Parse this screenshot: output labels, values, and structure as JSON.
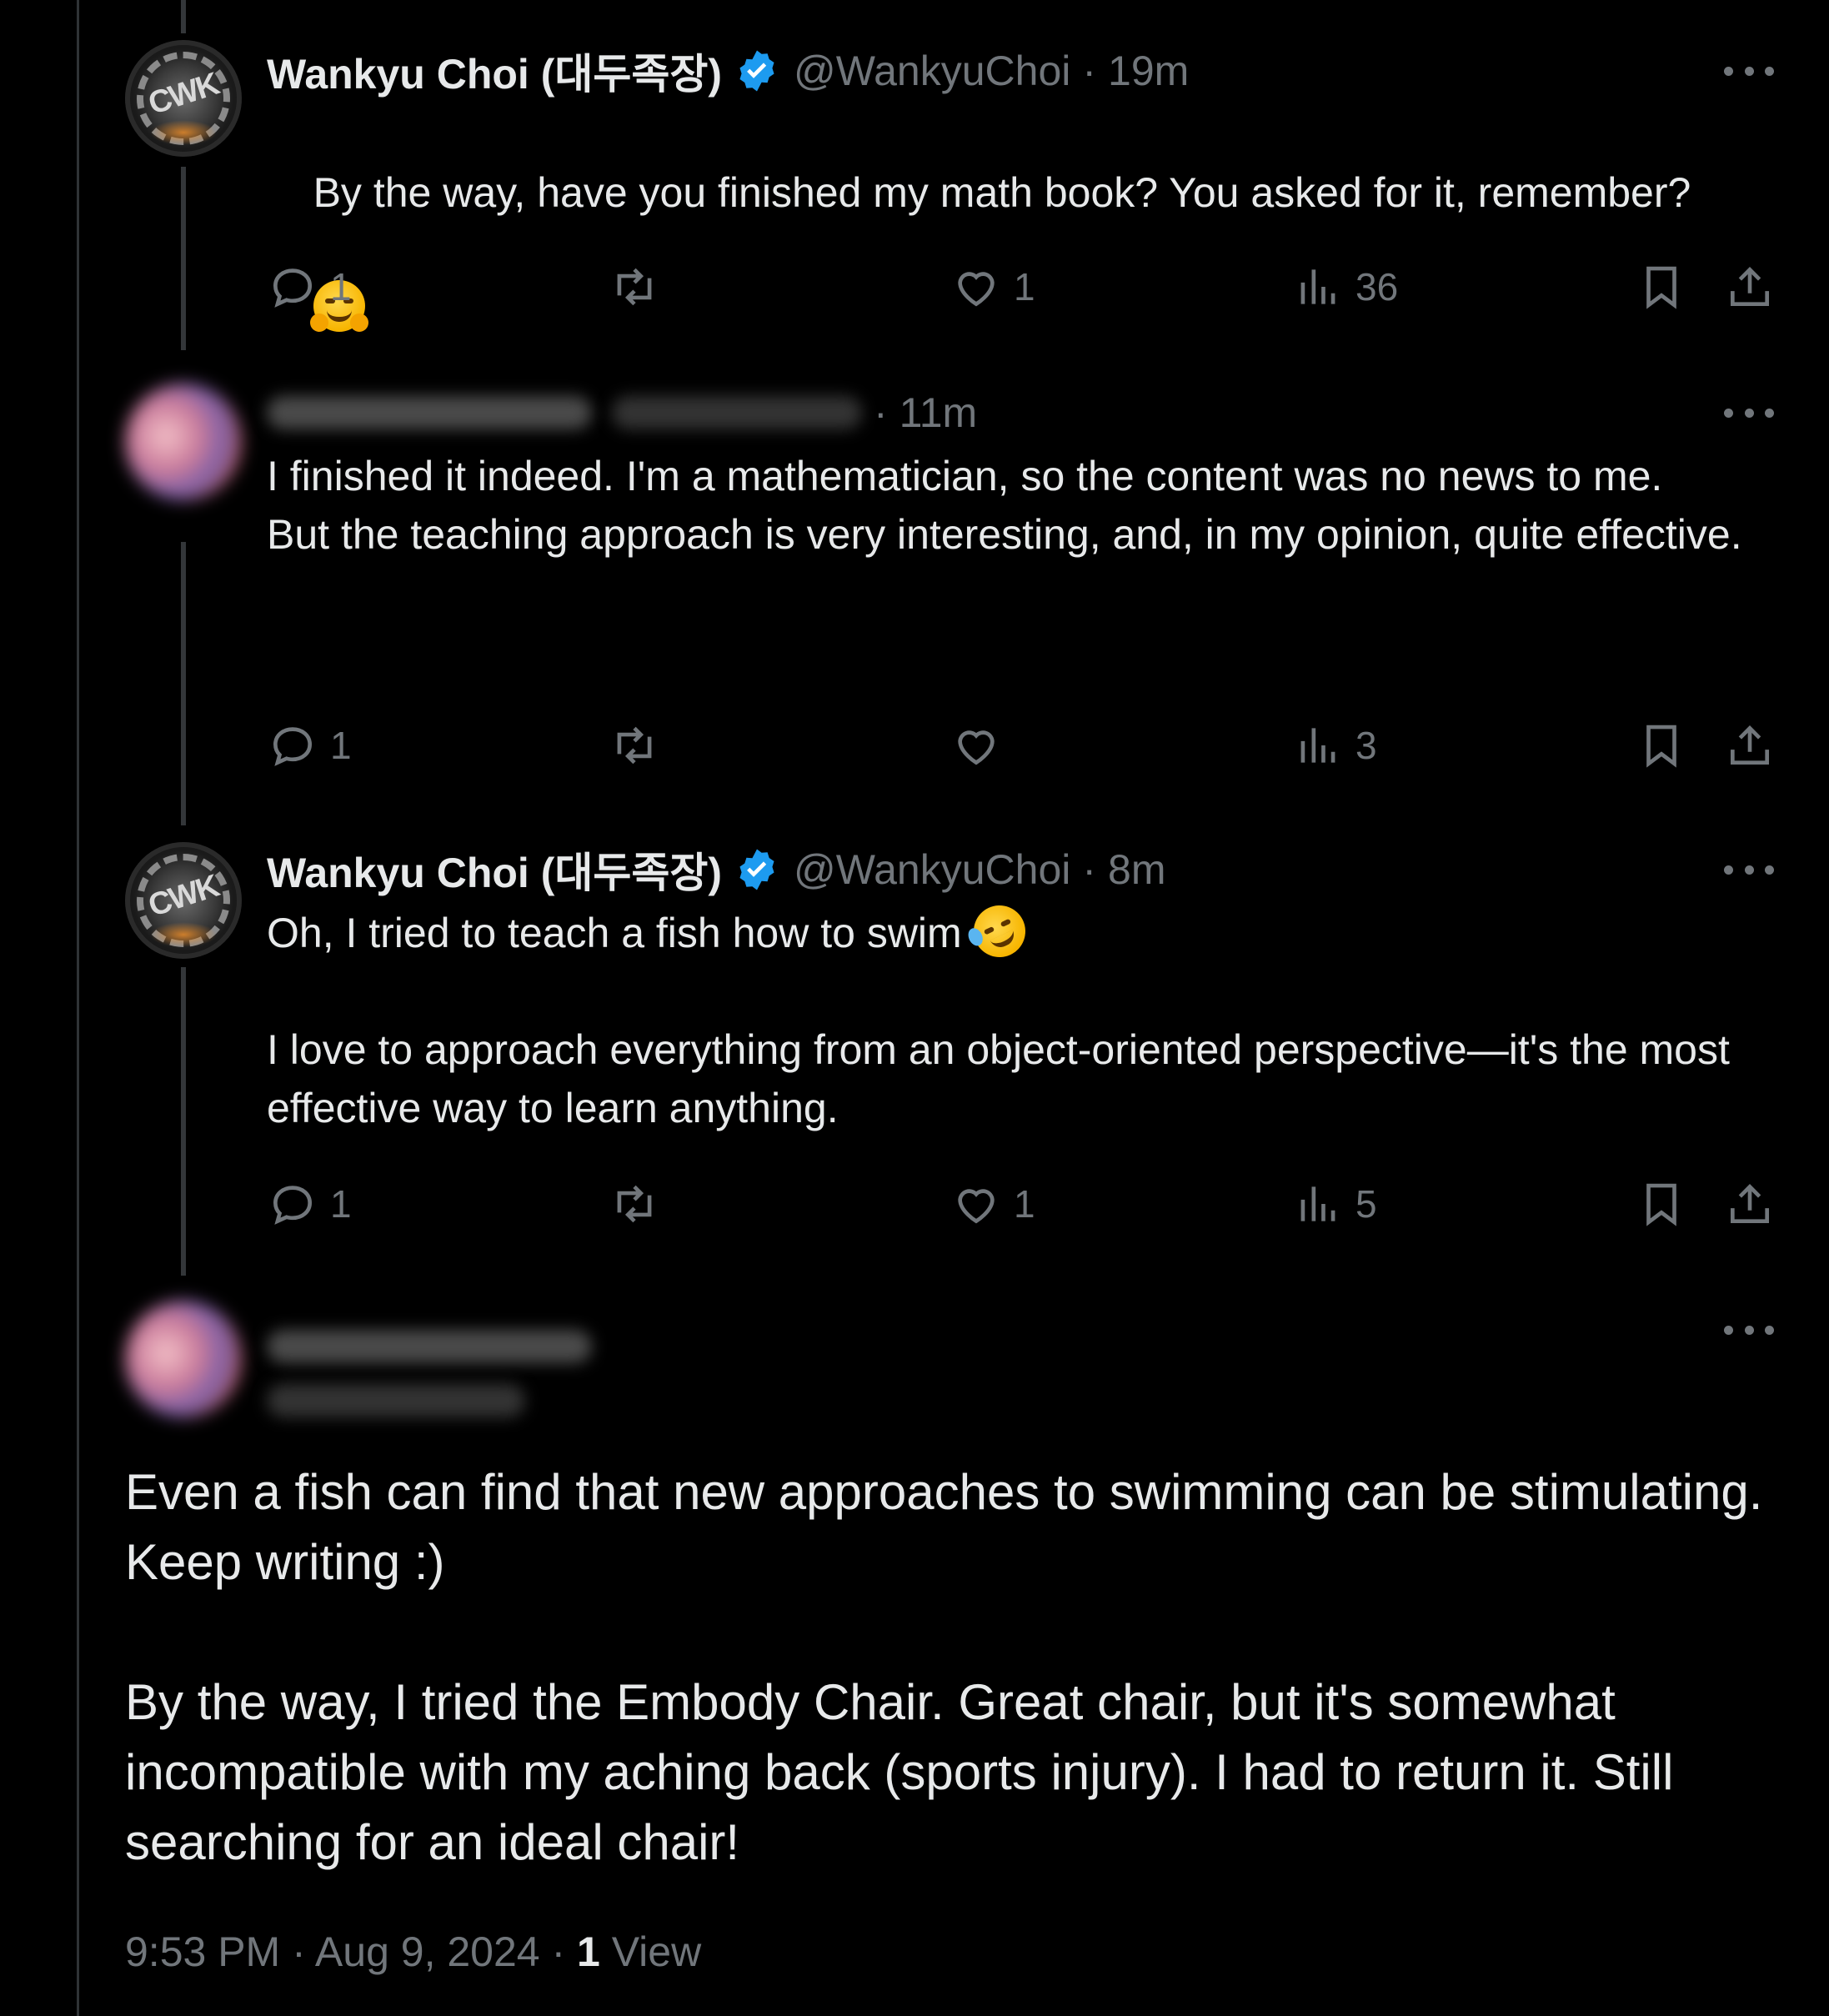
{
  "tweets": [
    {
      "name": "Wankyu Choi (대두족장)",
      "handle": "@WankyuChoi",
      "time": "19m",
      "avatar_text": "CWK",
      "text": "By the way, have you finished my math book? You asked for it, remember?",
      "emoji": "hugging-face",
      "replies": "1",
      "retweets": "",
      "likes": "1",
      "views": "36"
    },
    {
      "name": "",
      "handle": "",
      "time": "11m",
      "text": "I finished it indeed. I'm a mathematician, so the content was no news to me.\nBut the teaching approach is very interesting, and, in my opinion, quite effective.",
      "replies": "1",
      "retweets": "",
      "likes": "",
      "views": "3"
    },
    {
      "name": "Wankyu Choi (대두족장)",
      "handle": "@WankyuChoi",
      "time": "8m",
      "avatar_text": "CWK",
      "text_line1": "Oh, I tried to teach a fish how to swim",
      "emoji": "rolling-on-floor-laughing",
      "text_rest": "I love to approach everything from an object-oriented perspective—it's the most effective way to learn anything.",
      "replies": "1",
      "retweets": "",
      "likes": "1",
      "views": "5"
    }
  ],
  "main_tweet": {
    "text": "Even a fish can find that new approaches to swimming can be stimulating. Keep writing :)\n\nBy the way, I tried the Embody Chair. Great chair, but it's somewhat incompatible with my aching back (sports injury). I had to return it. Still searching for an ideal chair!",
    "time": "9:53 PM",
    "separator": " · ",
    "date": "Aug 9, 2024",
    "view_count": "1",
    "view_label": " View"
  },
  "colors": {
    "background": "#000000",
    "text_primary": "#e7e9ea",
    "text_secondary": "#71767b",
    "verified_blue": "#1d9bf0",
    "thread_line": "#333639"
  },
  "icons": [
    "reply-icon",
    "retweet-icon",
    "like-icon",
    "views-icon",
    "bookmark-icon",
    "share-icon",
    "more-icon",
    "verified-badge-icon"
  ]
}
